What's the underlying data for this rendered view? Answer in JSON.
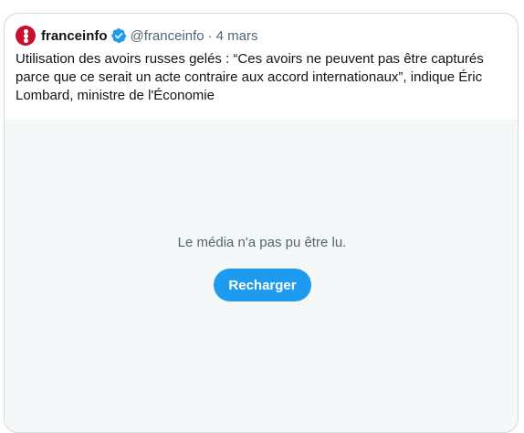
{
  "tweet": {
    "display_name": "franceinfo",
    "handle": "@franceinfo",
    "separator": "·",
    "date": "4 mars",
    "text": "Utilisation des avoirs russes gelés : “Ces avoirs ne peuvent pas être capturés parce que ce serait un acte contraire aux accord internationaux”, indique Éric Lombard, ministre de l'Économie",
    "avatar_icon": "franceinfo-logo-icon",
    "verified_icon": "verified-badge-icon",
    "brand_color": "#c8102e",
    "verified_color": "#1d9bf0"
  },
  "media": {
    "error_message": "Le média n'a pas pu être lu.",
    "reload_label": "Recharger",
    "button_color": "#1d9bf0"
  }
}
